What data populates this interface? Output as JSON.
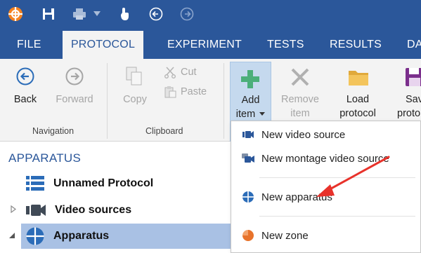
{
  "tabs": [
    {
      "label": "FILE"
    },
    {
      "label": "PROTOCOL"
    },
    {
      "label": "EXPERIMENT"
    },
    {
      "label": "TESTS"
    },
    {
      "label": "RESULTS"
    },
    {
      "label": "DA"
    }
  ],
  "ribbon": {
    "back": "Back",
    "forward": "Forward",
    "copy": "Copy",
    "cut": "Cut",
    "paste": "Paste",
    "add_item_line1": "Add",
    "add_item_line2": "item",
    "remove_item_line1": "Remove",
    "remove_item_line2": "item",
    "load_protocol_line1": "Load",
    "load_protocol_line2": "protocol",
    "save_protocol_line1": "Sav",
    "save_protocol_line2": "proto",
    "group_navigation": "Navigation",
    "group_clipboard": "Clipboard"
  },
  "panel": {
    "title": "APPARATUS",
    "items": [
      {
        "label": "Unnamed Protocol"
      },
      {
        "label": "Video sources"
      },
      {
        "label": "Apparatus"
      }
    ]
  },
  "menu": {
    "items": [
      {
        "label": "New video source"
      },
      {
        "label": "New montage video source"
      },
      {
        "label": "New apparatus"
      },
      {
        "label": "New zone"
      }
    ]
  },
  "colors": {
    "brand": "#2b579a",
    "ribbon_bg": "#f3f3f3",
    "selection": "#a9c1e4",
    "add_green": "#4caf7a",
    "annotation_red": "#e8322b"
  },
  "icons": {
    "app": "app-logo-icon",
    "save": "save-icon",
    "print": "print-icon",
    "touch": "touch-icon",
    "back_circle": "back-circle-icon",
    "forward_circle": "forward-circle-icon"
  }
}
